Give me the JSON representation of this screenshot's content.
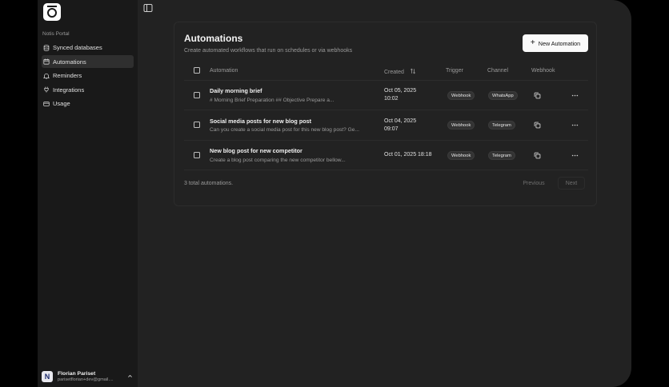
{
  "sidebar": {
    "portal_label": "Notis Portal",
    "items": [
      {
        "label": "Synced databases",
        "icon": "database-icon",
        "active": false
      },
      {
        "label": "Automations",
        "icon": "calendar-icon",
        "active": true
      },
      {
        "label": "Reminders",
        "icon": "bell-icon",
        "active": false
      },
      {
        "label": "Integrations",
        "icon": "plug-icon",
        "active": false
      },
      {
        "label": "Usage",
        "icon": "credit-card-icon",
        "active": false
      }
    ],
    "user": {
      "initial": "N",
      "name": "Florian Pariset",
      "email": "parisetflorian+dev@gmail...."
    }
  },
  "main": {
    "title": "Automations",
    "subtitle": "Create automated workflows that run on schedules or via webhooks",
    "new_button": "New Automation",
    "columns": {
      "automation": "Automation",
      "created": "Created",
      "trigger": "Trigger",
      "channel": "Channel",
      "webhook": "Webhook"
    },
    "rows": [
      {
        "title": "Daily morning brief",
        "desc": "# Morning Brief Preparation ## Objective Prepare a...",
        "date": "Oct 05, 2025",
        "time": "10:02",
        "trigger": "Webhook",
        "channel": "WhatsApp"
      },
      {
        "title": "Social media posts for new blog post",
        "desc": "Can you create a social media post for this new blog post? Ge...",
        "date": "Oct 04, 2025",
        "time": "09:07",
        "trigger": "Webhook",
        "channel": "Telegram"
      },
      {
        "title": "New blog post for new competitor",
        "desc": "Create a blog post comparing the new competitor bellow...",
        "date": "Oct 01, 2025 18:18",
        "time": "",
        "trigger": "Webhook",
        "channel": "Telegram"
      }
    ],
    "total": "3 total automations.",
    "previous": "Previous",
    "next": "Next"
  },
  "colors": {
    "background": "#000000",
    "sidebar": "#191919",
    "main": "#222222",
    "button": "#fafafa"
  }
}
